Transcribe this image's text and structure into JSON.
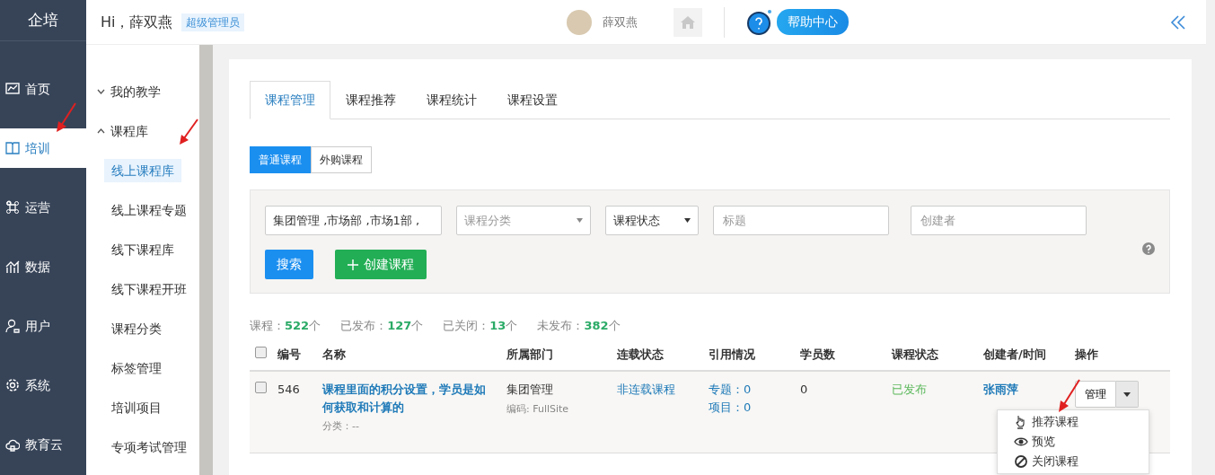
{
  "brand": "企培",
  "header": {
    "greeting": "Hi，薛双燕",
    "role_badge": "超级管理员",
    "user_name": "薛双燕",
    "help": "帮助中心"
  },
  "nav": [
    {
      "label": "首页",
      "selected": false
    },
    {
      "label": "培训",
      "selected": true
    },
    {
      "label": "运营",
      "selected": false
    },
    {
      "label": "数据",
      "selected": false
    },
    {
      "label": "用户",
      "selected": false
    },
    {
      "label": "系统",
      "selected": false
    },
    {
      "label": "教育云",
      "selected": false
    }
  ],
  "subnav": [
    {
      "label": "我的教学",
      "expanded": false
    },
    {
      "label": "课程库",
      "expanded": true,
      "children": [
        {
          "label": "线上课程库",
          "selected": true
        },
        {
          "label": "线上课程专题",
          "selected": false
        },
        {
          "label": "线下课程库",
          "selected": false
        },
        {
          "label": "线下课程开班",
          "selected": false
        },
        {
          "label": "课程分类",
          "selected": false
        },
        {
          "label": "标签管理",
          "selected": false
        },
        {
          "label": "培训项目",
          "selected": false
        },
        {
          "label": "专项考试管理",
          "selected": false
        }
      ]
    }
  ],
  "tabs": [
    {
      "label": "课程管理",
      "selected": true
    },
    {
      "label": "课程推荐",
      "selected": false
    },
    {
      "label": "课程统计",
      "selected": false
    },
    {
      "label": "课程设置",
      "selected": false
    }
  ],
  "type_toggle": [
    {
      "label": "普通课程",
      "selected": true
    },
    {
      "label": "外购课程",
      "selected": false
    }
  ],
  "filters": {
    "department": "集团管理 ,市场部 ,市场1部 ,",
    "category_placeholder": "课程分类",
    "status": "课程状态",
    "title_placeholder": "标题",
    "creator_placeholder": "创建者"
  },
  "buttons": {
    "search": "搜索",
    "create": "创建课程"
  },
  "stats": [
    {
      "label": "课程：",
      "value": "522",
      "unit": "个"
    },
    {
      "label": "已发布：",
      "value": "127",
      "unit": "个"
    },
    {
      "label": "已关闭：",
      "value": "13",
      "unit": "个"
    },
    {
      "label": "未发布：",
      "value": "382",
      "unit": "个"
    }
  ],
  "table": {
    "select_all_checked": false,
    "columns": [
      "编号",
      "名称",
      "所属部门",
      "连载状态",
      "引用情况",
      "学员数",
      "课程状态",
      "创建者/时间",
      "操作"
    ],
    "rows": [
      {
        "checked": false,
        "id": "546",
        "name": "课程里面的积分设置，学员是如何获取和计算的",
        "category": "分类：--",
        "department": "集团管理",
        "code": "编码: FullSite",
        "serial": "非连载课程",
        "refs": [
          "专题：0",
          "项目：0"
        ],
        "students": "0",
        "status": "已发布",
        "creator": "张雨萍",
        "action": "管理"
      }
    ]
  },
  "action_menu": [
    {
      "label": "推荐课程"
    },
    {
      "label": "预览"
    },
    {
      "label": "关闭课程"
    }
  ]
}
